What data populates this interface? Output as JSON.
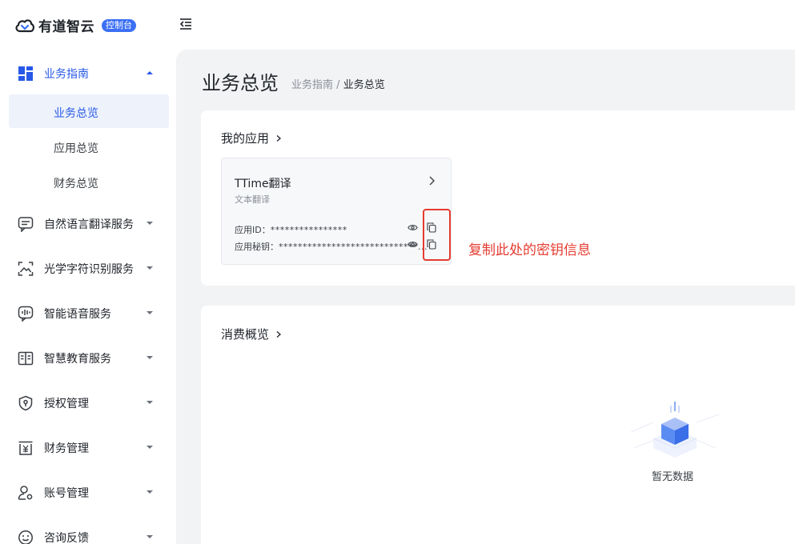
{
  "header": {
    "brand": "有道智云",
    "badge": "控制台"
  },
  "sidebar": {
    "groups": [
      {
        "label": "业务指南",
        "icon": "dashboard-grid-icon",
        "expanded": true
      },
      {
        "label": "自然语言翻译服务",
        "icon": "chat-translate-icon"
      },
      {
        "label": "光学字符识别服务",
        "icon": "scan-image-icon"
      },
      {
        "label": "智能语音服务",
        "icon": "voice-wave-icon"
      },
      {
        "label": "智慧教育服务",
        "icon": "education-book-icon"
      },
      {
        "label": "授权管理",
        "icon": "shield-key-icon"
      },
      {
        "label": "财务管理",
        "icon": "yuan-receipt-icon"
      },
      {
        "label": "账号管理",
        "icon": "user-settings-icon"
      },
      {
        "label": "咨询反馈",
        "icon": "smile-feedback-icon"
      }
    ],
    "sub_items": [
      {
        "label": "业务总览",
        "active": true
      },
      {
        "label": "应用总览"
      },
      {
        "label": "财务总览"
      }
    ]
  },
  "main": {
    "title": "业务总览",
    "breadcrumb": {
      "parent": "业务指南",
      "separator": "/",
      "current": "业务总览"
    },
    "my_apps": {
      "title": "我的应用",
      "app": {
        "name": "TTime翻译",
        "type": "文本翻译",
        "id_label": "应用ID：",
        "id_value": "****************",
        "secret_label": "应用秘钥：",
        "secret_value": "*****************************..."
      }
    },
    "annotation": "复制此处的密钥信息",
    "consumption": {
      "title": "消费概览",
      "empty_text": "暂无数据"
    }
  },
  "colors": {
    "accent": "#2759e8",
    "annotation": "#e53c30",
    "background": "#f2f3f5"
  }
}
